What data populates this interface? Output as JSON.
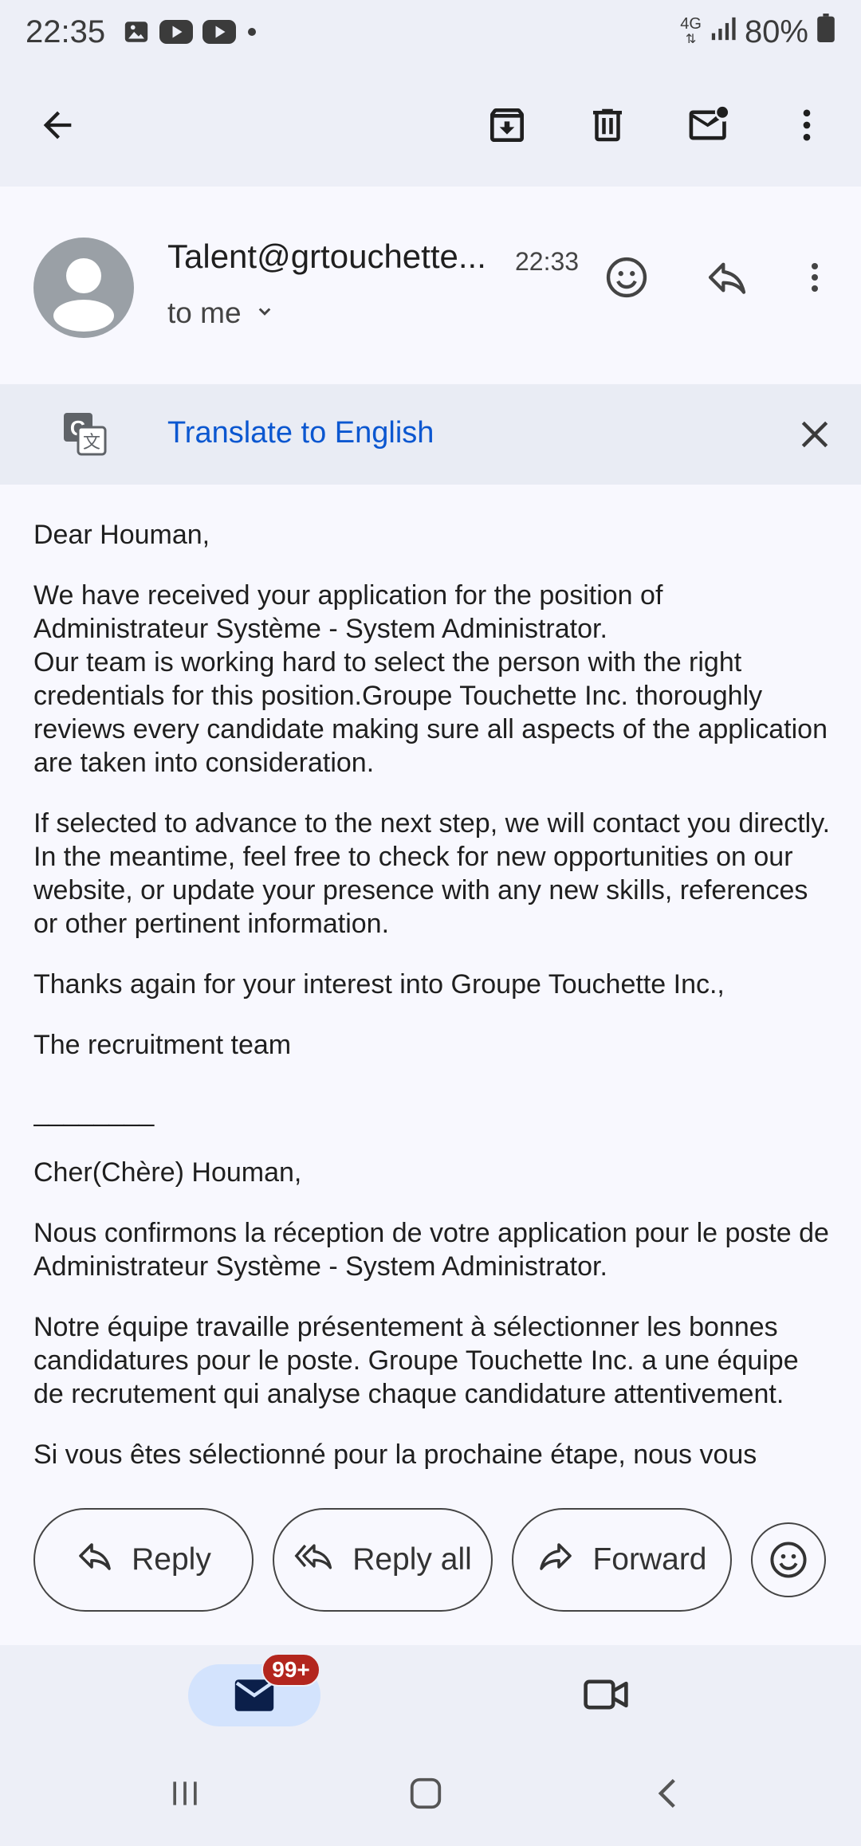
{
  "status_bar": {
    "time": "22:35",
    "network": "4G",
    "battery": "80%",
    "icons": [
      "gallery-icon",
      "youtube-icon",
      "youtube-icon",
      "dot-icon"
    ]
  },
  "toolbar": {
    "back_icon": "back-arrow-icon",
    "archive_icon": "archive-icon",
    "delete_icon": "trash-icon",
    "mark_unread_icon": "mark-unread-icon",
    "more_icon": "more-vert-icon"
  },
  "message": {
    "sender": "Talent@grtouchette...",
    "time": "22:33",
    "recipient": "to me",
    "emoji_icon": "emoji-icon",
    "reply_icon": "reply-icon",
    "more_icon": "more-vert-icon"
  },
  "translate": {
    "label": "Translate to English",
    "icon": "translate-icon",
    "close_icon": "close-icon"
  },
  "body": {
    "p1": "Dear Houman,",
    "p2": "We have received your application for the position of Administrateur Système - System Administrator.",
    "p2b": "Our team is working hard to select the person with the right credentials for this position.Groupe Touchette Inc. thoroughly reviews every candidate making sure all aspects of the application are taken into consideration.",
    "p3": "If selected to advance to the next step, we will contact you directly. In the meantime, feel free to check for new opportunities on our website, or update your presence with any new skills, references or other pertinent information.",
    "p4": "Thanks again for your interest into Groupe Touchette Inc.,",
    "p5": "The recruitment team",
    "divider": "________",
    "p6": "Cher(Chère) Houman,",
    "p7": "Nous confirmons la réception de votre application pour le poste de Administrateur Système - System Administrator.",
    "p8": "Notre équipe travaille présentement à sélectionner les bonnes candidatures pour le poste. Groupe Touchette Inc. a une équipe de recrutement qui analyse chaque candidature attentivement.",
    "p9": "Si vous êtes sélectionné pour la prochaine étape, nous vous"
  },
  "actions": {
    "reply": "Reply",
    "reply_all": "Reply all",
    "forward": "Forward"
  },
  "bottom_nav": {
    "mail_badge": "99+",
    "mail_icon": "mail-icon",
    "meet_icon": "video-icon"
  },
  "colors": {
    "accent_blue": "#0b57d0",
    "badge_red": "#b3261e",
    "nav_active": "#d3e3fd"
  }
}
